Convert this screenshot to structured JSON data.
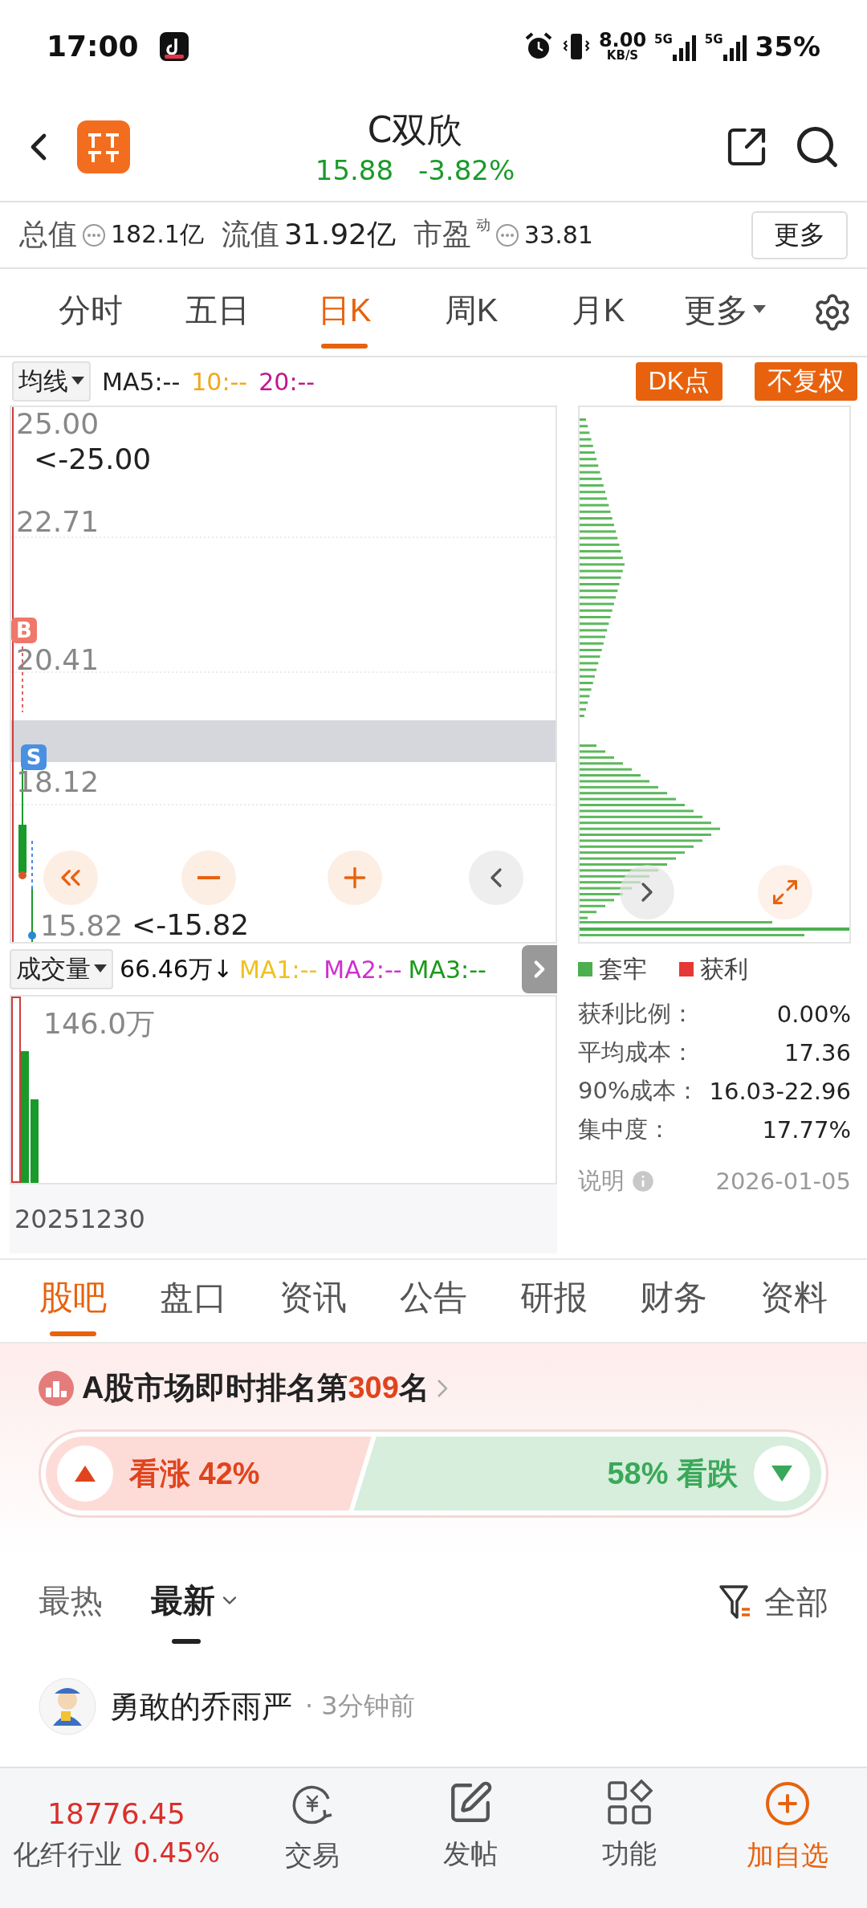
{
  "status_bar": {
    "time": "17:00",
    "net_speed": "8.00",
    "net_unit": "KB/S",
    "signal_1": "5G",
    "signal_2": "5G",
    "battery": "35%"
  },
  "header": {
    "title": "C双欣",
    "price": "15.88",
    "change": "-3.82%"
  },
  "stats": [
    {
      "label": "总值",
      "value": "182.1亿",
      "info": true
    },
    {
      "label": "流值",
      "value": "31.92亿",
      "info": false
    },
    {
      "label": "市盈",
      "sup": "动",
      "value": "33.81",
      "info": true
    }
  ],
  "more_button": "更多",
  "period_tabs": [
    {
      "label": "分时",
      "selected": false,
      "dropdown": false
    },
    {
      "label": "五日",
      "selected": false,
      "dropdown": false
    },
    {
      "label": "日K",
      "selected": true,
      "dropdown": false
    },
    {
      "label": "周K",
      "selected": false,
      "dropdown": false
    },
    {
      "label": "月K",
      "selected": false,
      "dropdown": false
    },
    {
      "label": "更多",
      "selected": false,
      "dropdown": true
    }
  ],
  "chart_header": {
    "indicator": "均线",
    "ma5": "MA5:--",
    "ma10": "10:--",
    "ma20": "20:--",
    "dk_button": "DK点",
    "adjust_button": "不复权"
  },
  "price_axis": [
    "25.00",
    "22.71",
    "20.41",
    "18.12",
    "15.82"
  ],
  "high_marker": "<-25.00",
  "low_marker": "<-15.82",
  "trade_markers": [
    {
      "label": "B",
      "kind": "buy"
    },
    {
      "label": "S",
      "kind": "sell"
    }
  ],
  "volume_header": {
    "indicator": "成交量",
    "value": "66.46万↓",
    "ma1": "MA1:--",
    "ma2": "MA2:--",
    "ma3": "MA3:--"
  },
  "volume_axis": "146.0万",
  "date": "20251230",
  "chip_legend": [
    {
      "label": "套牢",
      "color": "#4caf50"
    },
    {
      "label": "获利",
      "color": "#e53935"
    }
  ],
  "chip_stats": [
    {
      "label": "获利比例：",
      "value": "0.00%"
    },
    {
      "label": "平均成本：",
      "value": "17.36"
    },
    {
      "label": "90%成本：",
      "value": "16.03-22.96"
    },
    {
      "label": "集中度：",
      "value": "17.77%"
    }
  ],
  "chip_note": "说明",
  "chip_date": "2026-01-05",
  "section_tabs": [
    {
      "label": "股吧",
      "selected": true
    },
    {
      "label": "盘口",
      "selected": false
    },
    {
      "label": "资讯",
      "selected": false
    },
    {
      "label": "公告",
      "selected": false
    },
    {
      "label": "研报",
      "selected": false
    },
    {
      "label": "财务",
      "selected": false
    },
    {
      "label": "资料",
      "selected": false
    }
  ],
  "ranking": {
    "prefix": "A股市场即时排名第",
    "rank": "309",
    "suffix": "名"
  },
  "sentiment": {
    "bull_label": "看涨 42%",
    "bear_label": "58% 看跌"
  },
  "sort_tabs": [
    {
      "label": "最热",
      "selected": false,
      "dropdown": false
    },
    {
      "label": "最新",
      "selected": true,
      "dropdown": true
    }
  ],
  "filter": "全部",
  "post": {
    "author": "勇敢的乔雨严",
    "time": "· 3分钟前"
  },
  "bottom_bar": {
    "index_value": "18776.45",
    "industry": "化纤行业",
    "industry_change": "0.45%",
    "actions": [
      {
        "label": "交易",
        "kind": "trade",
        "highlight": false
      },
      {
        "label": "发帖",
        "kind": "post",
        "highlight": false
      },
      {
        "label": "功能",
        "kind": "tools",
        "highlight": false
      },
      {
        "label": "加自选",
        "kind": "add",
        "highlight": true
      }
    ]
  }
}
